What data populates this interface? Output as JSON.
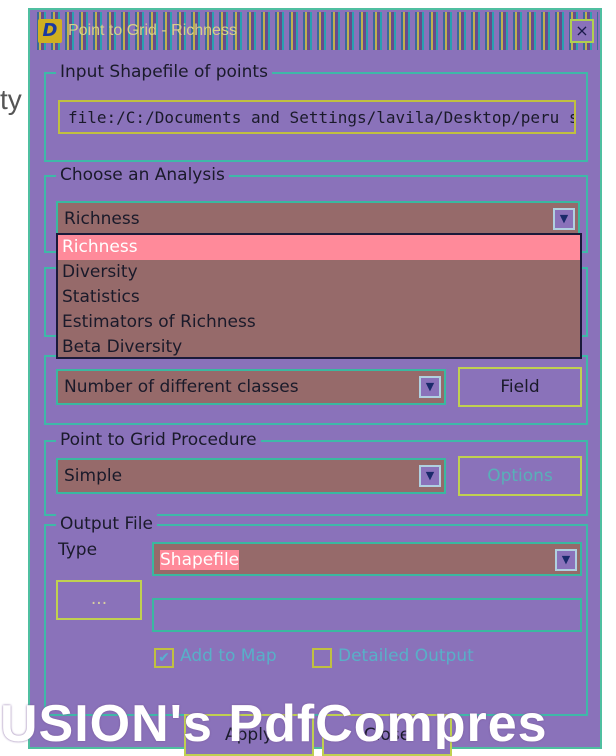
{
  "background": {
    "partial_text": "ty"
  },
  "window": {
    "title": "Point to Grid - Richness",
    "icon_glyph": "D",
    "close_glyph": "×"
  },
  "input_group": {
    "label": "Input Shapefile of points",
    "value": "file:/C:/Documents and Settings/lavila/Desktop/peru sh"
  },
  "analysis_group": {
    "label": "Choose an Analysis",
    "selected": "Richness",
    "options": [
      "Richness",
      "Diversity",
      "Statistics",
      "Estimators of Richness",
      "Beta Diversity"
    ]
  },
  "measure_group": {
    "selected": "Number of different classes",
    "field_button": "Field"
  },
  "procedure_group": {
    "label": "Point to Grid Procedure",
    "selected": "Simple",
    "options_button": "Options"
  },
  "output_group": {
    "label": "Output File",
    "type_label": "Type",
    "type_selected": "Shapefile",
    "browse_button": "...",
    "path_value": "",
    "add_to_map_label": "Add to Map",
    "add_to_map_checked": true,
    "detailed_output_label": "Detailed Output",
    "detailed_output_checked": false
  },
  "footer": {
    "apply_button": "Apply",
    "close_button": "Close"
  },
  "overlay": {
    "text": "USION's PdfCompres"
  },
  "colors": {
    "window_bg": "#8a72ba",
    "border": "#3fb8a8",
    "combo_bg": "#966a6a",
    "selection": "#ff8a9a",
    "disabled_text": "#58b0b8"
  }
}
